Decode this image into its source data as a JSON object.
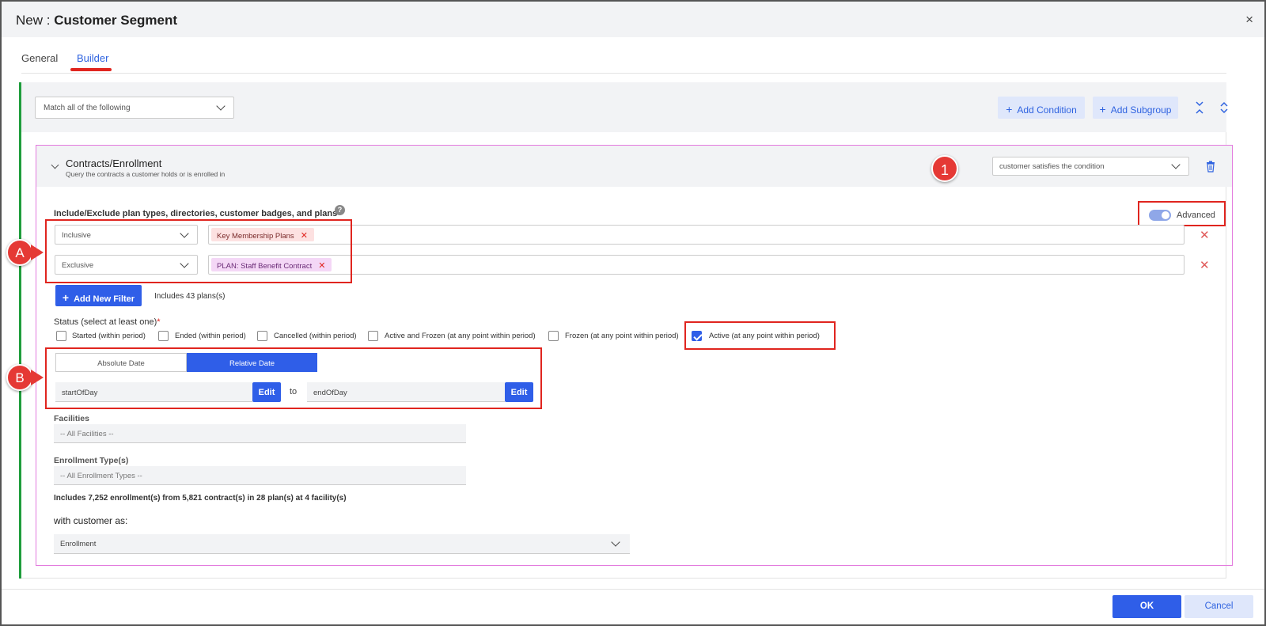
{
  "window": {
    "title_prefix": "New : ",
    "title_main": "Customer Segment",
    "close": "×"
  },
  "tabs": [
    {
      "label": "General"
    },
    {
      "label": "Builder",
      "active": true
    }
  ],
  "group": {
    "match_select": "Match all of the following",
    "add_condition": "Add Condition",
    "add_subgroup": "Add Subgroup"
  },
  "condition": {
    "title": "Contracts/Enrollment",
    "subtitle": "Query the contracts a customer holds or is enrolled in",
    "satisfy_select": "customer satisfies the condition",
    "callout_1": "1"
  },
  "filters": {
    "label": "Include/Exclude plan types, directories, customer badges, and plans",
    "help": "?",
    "advanced_label": "Advanced",
    "rows": [
      {
        "mode": "Inclusive",
        "chip": "Key Membership Plans"
      },
      {
        "mode": "Exclusive",
        "chip": "PLAN: Staff Benefit Contract"
      }
    ],
    "callout_a": "A",
    "add_new_filter": "Add New Filter",
    "includes_plans": "Includes 43 plans(s)"
  },
  "status": {
    "label": "Status (select at least one)",
    "required": "*",
    "options": [
      {
        "label": "Started (within period)",
        "checked": false
      },
      {
        "label": "Ended (within period)",
        "checked": false
      },
      {
        "label": "Cancelled (within period)",
        "checked": false
      },
      {
        "label": "Active and Frozen (at any point within period)",
        "checked": false
      },
      {
        "label": "Frozen (at any point within period)",
        "checked": false
      },
      {
        "label": "Active (at any point within period)",
        "checked": true
      }
    ]
  },
  "dates": {
    "absolute": "Absolute Date",
    "relative": "Relative Date",
    "start_value": "startOfDay",
    "end_value": "endOfDay",
    "edit": "Edit",
    "to": "to",
    "callout_b": "B"
  },
  "facilities": {
    "label": "Facilities",
    "value": "-- All Facilities --"
  },
  "enrollment_types": {
    "label": "Enrollment Type(s)",
    "value": "-- All Enrollment Types --"
  },
  "summary": "Includes 7,252 enrollment(s) from 5,821 contract(s) in 28 plan(s) at 4 facility(s)",
  "customer_as": {
    "label": "with customer as:",
    "value": "Enrollment"
  },
  "footer": {
    "ok": "OK",
    "cancel": "Cancel"
  },
  "colors": {
    "accent": "#2f5ee8",
    "callout": "#e53935",
    "group_bar": "#1f9d3c",
    "condition_border": "#e37bde"
  }
}
